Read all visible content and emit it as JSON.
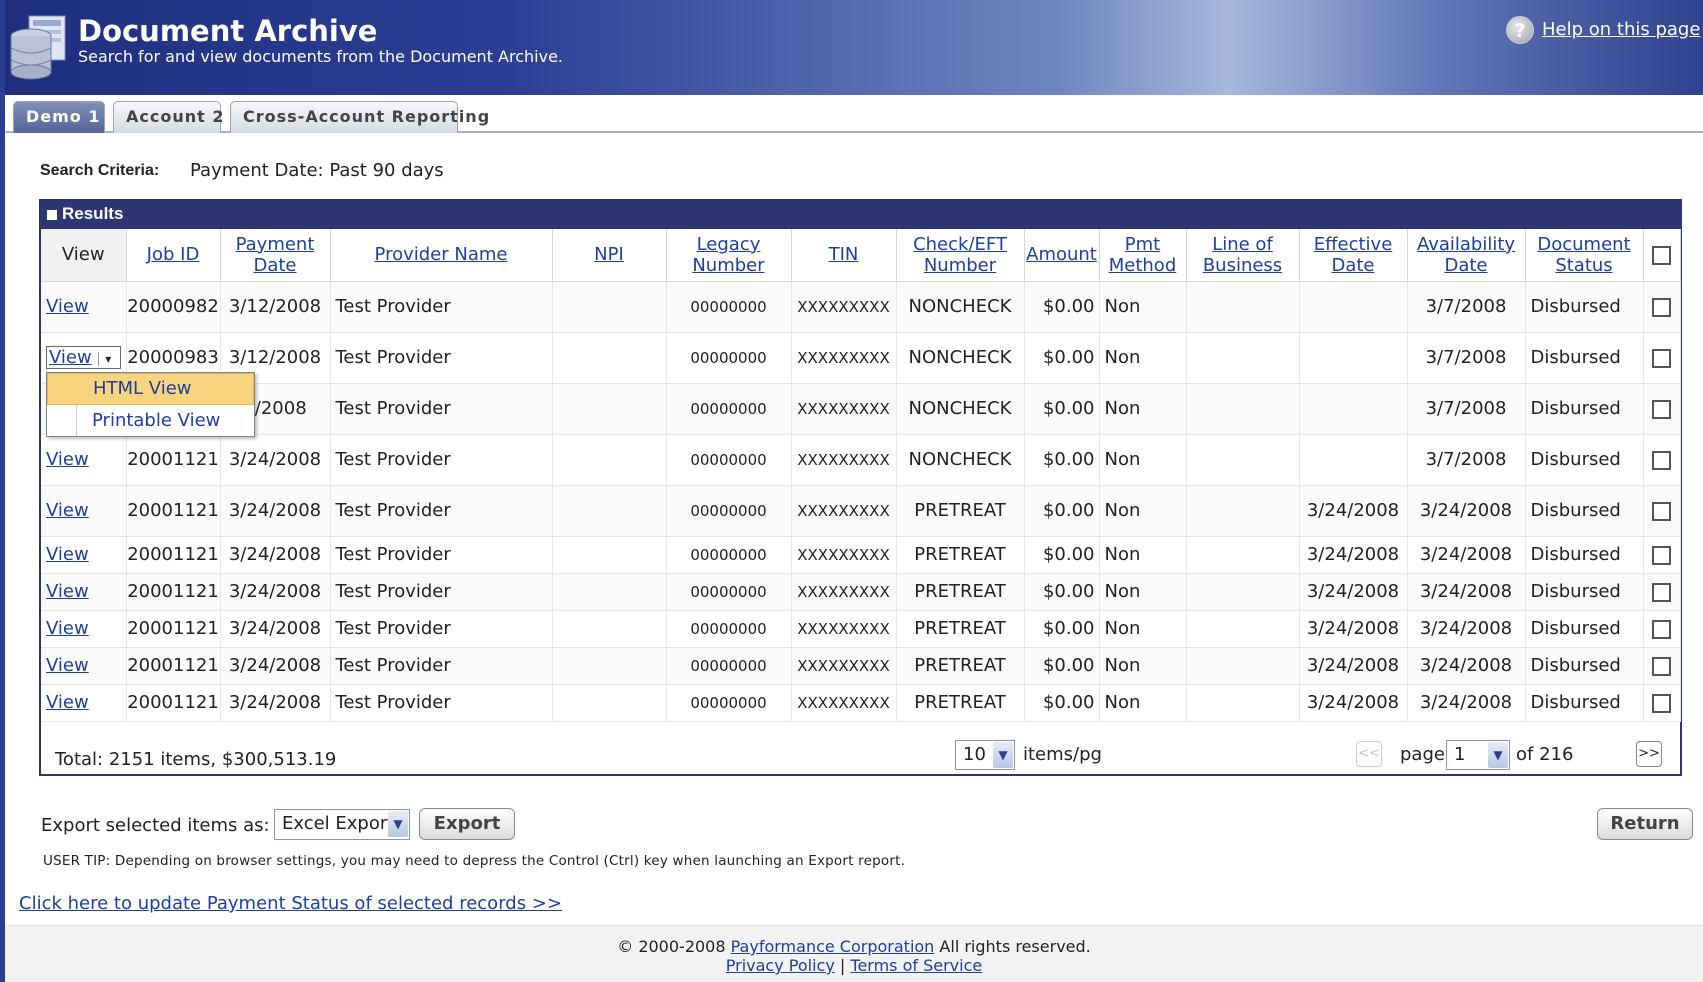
{
  "header": {
    "title": "Document Archive",
    "subtitle": "Search for and view documents from the Document Archive.",
    "help_link": "Help on this page",
    "help_icon": "?"
  },
  "tabs": [
    {
      "label": "Demo 1",
      "active": true
    },
    {
      "label": "Account 2",
      "active": false
    },
    {
      "label": "Cross-Account Reporting",
      "active": false
    }
  ],
  "search": {
    "label": "Search Criteria:",
    "value": "Payment Date: Past 90 days"
  },
  "results": {
    "title": "Results",
    "columns": [
      "View",
      "Job ID",
      "Payment Date",
      "Provider Name",
      "NPI",
      "Legacy Number",
      "TIN",
      "Check/EFT Number",
      "Amount",
      "Pmt Method",
      "Line of Business",
      "Effective Date",
      "Availability Date",
      "Document Status"
    ],
    "view_label": "View",
    "rows": [
      {
        "job_id": "20000982",
        "payment_date": "3/12/2008",
        "provider": "Test Provider",
        "npi": "",
        "legacy": "00000000",
        "tin": "XXXXXXXXX",
        "check": "NONCHECK",
        "amount": "$0.00",
        "method": "Non",
        "line": "",
        "effective": "",
        "availability": "3/7/2008",
        "status": "Disbursed"
      },
      {
        "job_id": "20000983",
        "payment_date": "3/12/2008",
        "provider": "Test Provider",
        "npi": "",
        "legacy": "00000000",
        "tin": "XXXXXXXXX",
        "check": "NONCHECK",
        "amount": "$0.00",
        "method": "Non",
        "line": "",
        "effective": "",
        "availability": "3/7/2008",
        "status": "Disbursed"
      },
      {
        "job_id": "",
        "payment_date": "2/2008",
        "provider": "Test Provider",
        "npi": "",
        "legacy": "00000000",
        "tin": "XXXXXXXXX",
        "check": "NONCHECK",
        "amount": "$0.00",
        "method": "Non",
        "line": "",
        "effective": "",
        "availability": "3/7/2008",
        "status": "Disbursed"
      },
      {
        "job_id": "20001121",
        "payment_date": "3/24/2008",
        "provider": "Test Provider",
        "npi": "",
        "legacy": "00000000",
        "tin": "XXXXXXXXX",
        "check": "NONCHECK",
        "amount": "$0.00",
        "method": "Non",
        "line": "",
        "effective": "",
        "availability": "3/7/2008",
        "status": "Disbursed"
      },
      {
        "job_id": "20001121",
        "payment_date": "3/24/2008",
        "provider": "Test Provider",
        "npi": "",
        "legacy": "00000000",
        "tin": "XXXXXXXXX",
        "check": "PRETREAT",
        "amount": "$0.00",
        "method": "Non",
        "line": "",
        "effective": "3/24/2008",
        "availability": "3/24/2008",
        "status": "Disbursed"
      },
      {
        "job_id": "20001121",
        "payment_date": "3/24/2008",
        "provider": "Test Provider",
        "npi": "",
        "legacy": "00000000",
        "tin": "XXXXXXXXX",
        "check": "PRETREAT",
        "amount": "$0.00",
        "method": "Non",
        "line": "",
        "effective": "3/24/2008",
        "availability": "3/24/2008",
        "status": "Disbursed"
      },
      {
        "job_id": "20001121",
        "payment_date": "3/24/2008",
        "provider": "Test Provider",
        "npi": "",
        "legacy": "00000000",
        "tin": "XXXXXXXXX",
        "check": "PRETREAT",
        "amount": "$0.00",
        "method": "Non",
        "line": "",
        "effective": "3/24/2008",
        "availability": "3/24/2008",
        "status": "Disbursed"
      },
      {
        "job_id": "20001121",
        "payment_date": "3/24/2008",
        "provider": "Test Provider",
        "npi": "",
        "legacy": "00000000",
        "tin": "XXXXXXXXX",
        "check": "PRETREAT",
        "amount": "$0.00",
        "method": "Non",
        "line": "",
        "effective": "3/24/2008",
        "availability": "3/24/2008",
        "status": "Disbursed"
      },
      {
        "job_id": "20001121",
        "payment_date": "3/24/2008",
        "provider": "Test Provider",
        "npi": "",
        "legacy": "00000000",
        "tin": "XXXXXXXXX",
        "check": "PRETREAT",
        "amount": "$0.00",
        "method": "Non",
        "line": "",
        "effective": "3/24/2008",
        "availability": "3/24/2008",
        "status": "Disbursed"
      },
      {
        "job_id": "20001121",
        "payment_date": "3/24/2008",
        "provider": "Test Provider",
        "npi": "",
        "legacy": "00000000",
        "tin": "XXXXXXXXX",
        "check": "PRETREAT",
        "amount": "$0.00",
        "method": "Non",
        "line": "",
        "effective": "3/24/2008",
        "availability": "3/24/2008",
        "status": "Disbursed"
      }
    ],
    "view_menu": {
      "items": [
        "HTML View",
        "Printable View"
      ],
      "highlighted": "HTML View"
    },
    "total": "Total: 2151 items, $300,513.19",
    "page_size": "10",
    "page_size_suffix": "items/pg",
    "page_label": "page",
    "page_current": "1",
    "page_of": "of 216",
    "prev_button": "<<",
    "next_button": ">>"
  },
  "export": {
    "label": "Export selected items as:",
    "format": "Excel Export",
    "button": "Export",
    "return_button": "Return",
    "user_tip": "USER TIP: Depending on browser settings, you may need to depress the Control (Ctrl) key when launching an Export report.",
    "update_link": "Click here to update Payment Status of selected records >>"
  },
  "footer": {
    "copyright": "© 2000-2008",
    "company": "Payformance Corporation",
    "rights": "All rights reserved.",
    "privacy": "Privacy Policy",
    "separator": "|",
    "terms": "Terms of Service"
  },
  "colors": {
    "header_dark": "#1f2f7e",
    "panel_bar": "#2d3572",
    "link": "#1c3fa0",
    "menu_highlight": "#f8d47e"
  }
}
